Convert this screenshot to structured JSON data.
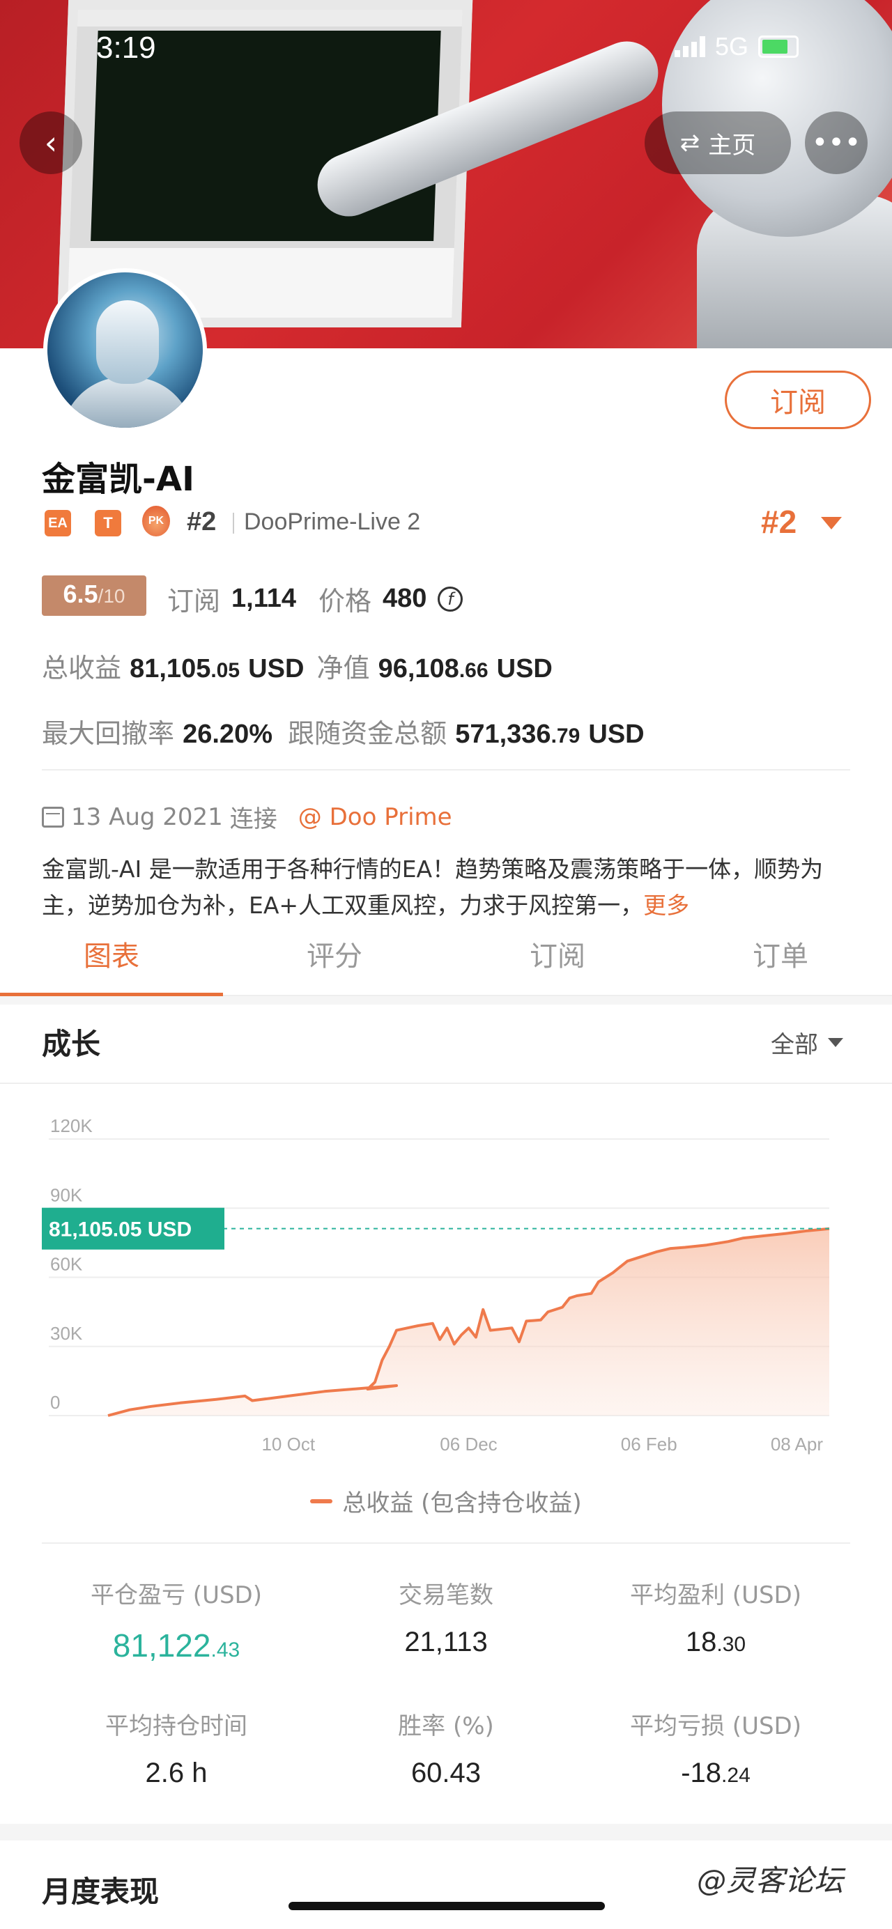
{
  "status_bar": {
    "time": "3:19",
    "network": "5G"
  },
  "nav": {
    "home_label": "主页",
    "more_glyph": "•••",
    "back_glyph": "‹",
    "home_glyph": "⇄"
  },
  "profile": {
    "name": "金富凯-AI",
    "subscribe_label": "订阅",
    "badges": {
      "ea": "EA",
      "t": "T",
      "pk": "PK"
    },
    "rank_small": "#2",
    "server": "DooPrime-Live 2",
    "rank_big": "#2"
  },
  "score": {
    "value": "6.5",
    "max": "/10"
  },
  "subscriptions": {
    "label": "订阅",
    "value": "1,114"
  },
  "price": {
    "label": "价格",
    "value": "480",
    "icon": "coin-icon"
  },
  "total_profit": {
    "label": "总收益",
    "int": "81,105",
    "frac": ".05",
    "unit": "USD"
  },
  "equity": {
    "label": "净值",
    "int": "96,108",
    "frac": ".66",
    "unit": "USD"
  },
  "max_drawdown": {
    "label": "最大回撤率",
    "value": "26.20%"
  },
  "follow_funds": {
    "label": "跟随资金总额",
    "int": "571,336",
    "frac": ".79",
    "unit": "USD"
  },
  "connect": {
    "date": "13 Aug 2021",
    "suffix": "连接",
    "broker": "@ Doo Prime"
  },
  "description": {
    "text": "金富凯-AI 是一款适用于各种行情的EA！趋势策略及震荡策略于一体，顺势为主，逆势加仓为补，EA+人工双重风控，力求于风控第一，",
    "more": "更多"
  },
  "tabs": [
    "图表",
    "评分",
    "订阅",
    "订单"
  ],
  "growth": {
    "title": "成长",
    "range": "全部"
  },
  "chart_data": {
    "type": "area",
    "series": [
      {
        "name": "总收益 (包含持仓收益)",
        "color": "#ef7a4c"
      }
    ],
    "x_labels": [
      "10 Oct",
      "06 Dec",
      "06 Feb",
      "08 Apr"
    ],
    "y_ticks": [
      "120K",
      "90K",
      "60K",
      "30K",
      "0"
    ],
    "ylim": [
      0,
      120000
    ],
    "current_value_label": "81,105.05 USD",
    "current_value": 81105.05,
    "points": [
      [
        0,
        0
      ],
      [
        0.03,
        2500
      ],
      [
        0.06,
        4000
      ],
      [
        0.1,
        5500
      ],
      [
        0.15,
        7000
      ],
      [
        0.19,
        8500
      ],
      [
        0.2,
        6500
      ],
      [
        0.25,
        8500
      ],
      [
        0.3,
        10500
      ],
      [
        0.36,
        12000
      ],
      [
        0.4,
        13000
      ],
      [
        0.36,
        11500
      ],
      [
        0.37,
        14500
      ],
      [
        0.38,
        24000
      ],
      [
        0.39,
        30000
      ],
      [
        0.4,
        37000
      ],
      [
        0.43,
        39000
      ],
      [
        0.45,
        40000
      ],
      [
        0.46,
        33000
      ],
      [
        0.47,
        38000
      ],
      [
        0.48,
        31000
      ],
      [
        0.49,
        35000
      ],
      [
        0.5,
        38000
      ],
      [
        0.51,
        34000
      ],
      [
        0.52,
        46000
      ],
      [
        0.53,
        37000
      ],
      [
        0.56,
        38000
      ],
      [
        0.57,
        32000
      ],
      [
        0.58,
        41000
      ],
      [
        0.6,
        41500
      ],
      [
        0.61,
        45000
      ],
      [
        0.63,
        47000
      ],
      [
        0.64,
        51000
      ],
      [
        0.65,
        52000
      ],
      [
        0.67,
        53000
      ],
      [
        0.68,
        58000
      ],
      [
        0.7,
        62000
      ],
      [
        0.72,
        67000
      ],
      [
        0.74,
        69000
      ],
      [
        0.76,
        71000
      ],
      [
        0.78,
        72500
      ],
      [
        0.8,
        73000
      ],
      [
        0.83,
        74000
      ],
      [
        0.86,
        75500
      ],
      [
        0.88,
        77000
      ],
      [
        0.91,
        78000
      ],
      [
        0.94,
        79000
      ],
      [
        0.97,
        80200
      ],
      [
        1.0,
        81105
      ]
    ]
  },
  "stats": [
    {
      "label": "平仓盈亏 (USD)",
      "int": "81,122",
      "frac": ".43",
      "color": "#2bb39c"
    },
    {
      "label": "交易笔数",
      "int": "21,113",
      "frac": ""
    },
    {
      "label": "平均盈利 (USD)",
      "int": "18",
      "frac": ".30"
    },
    {
      "label": "平均持仓时间",
      "int": "2.6 h",
      "frac": ""
    },
    {
      "label": "胜率 (%)",
      "int": "60.43",
      "frac": ""
    },
    {
      "label": "平均亏损 (USD)",
      "int": "-18",
      "frac": ".24"
    }
  ],
  "monthly": {
    "title": "月度表现"
  },
  "watermark": "@灵客论坛"
}
